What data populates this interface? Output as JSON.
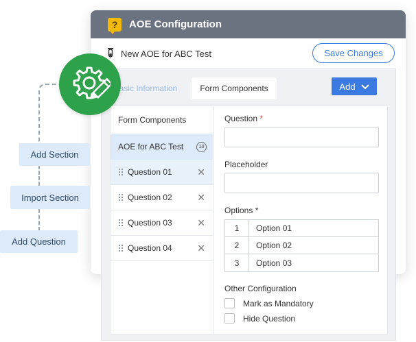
{
  "window": {
    "title": "AOE Configuration",
    "title_icon": "question-help-icon",
    "subtitle": "New AOE for ABC Test",
    "subtitle_icon": "test-tube-icon",
    "save_label": "Save Changes"
  },
  "actions": {
    "add_section": "Add Section",
    "import_section": "Import Section",
    "add_question": "Add Question",
    "badge_icon": "settings-edit-icon"
  },
  "tabs": {
    "basic": "Basic Information",
    "form": "Form Components",
    "add_label": "Add"
  },
  "components": {
    "header": "Form Components",
    "section_name": "AOE for ABC Test",
    "section_count": "10",
    "questions": [
      "Question 01",
      "Question 02",
      "Question 03",
      "Question 04"
    ]
  },
  "form": {
    "question_label": "Question",
    "required_mark": "*",
    "placeholder_label": "Placeholder",
    "options_label": "Options *",
    "options": [
      {
        "num": "1",
        "value": "Option 01"
      },
      {
        "num": "2",
        "value": "Option 02"
      },
      {
        "num": "3",
        "value": "Option 03"
      }
    ],
    "other_label": "Other Configuration",
    "mandatory_label": "Mark as Mandatory",
    "hide_label": "Hide Question"
  },
  "colors": {
    "accent": "#3b7ae0",
    "titlebar": "#6b7280",
    "badge": "#2ea24a",
    "chip": "#dceafa"
  }
}
